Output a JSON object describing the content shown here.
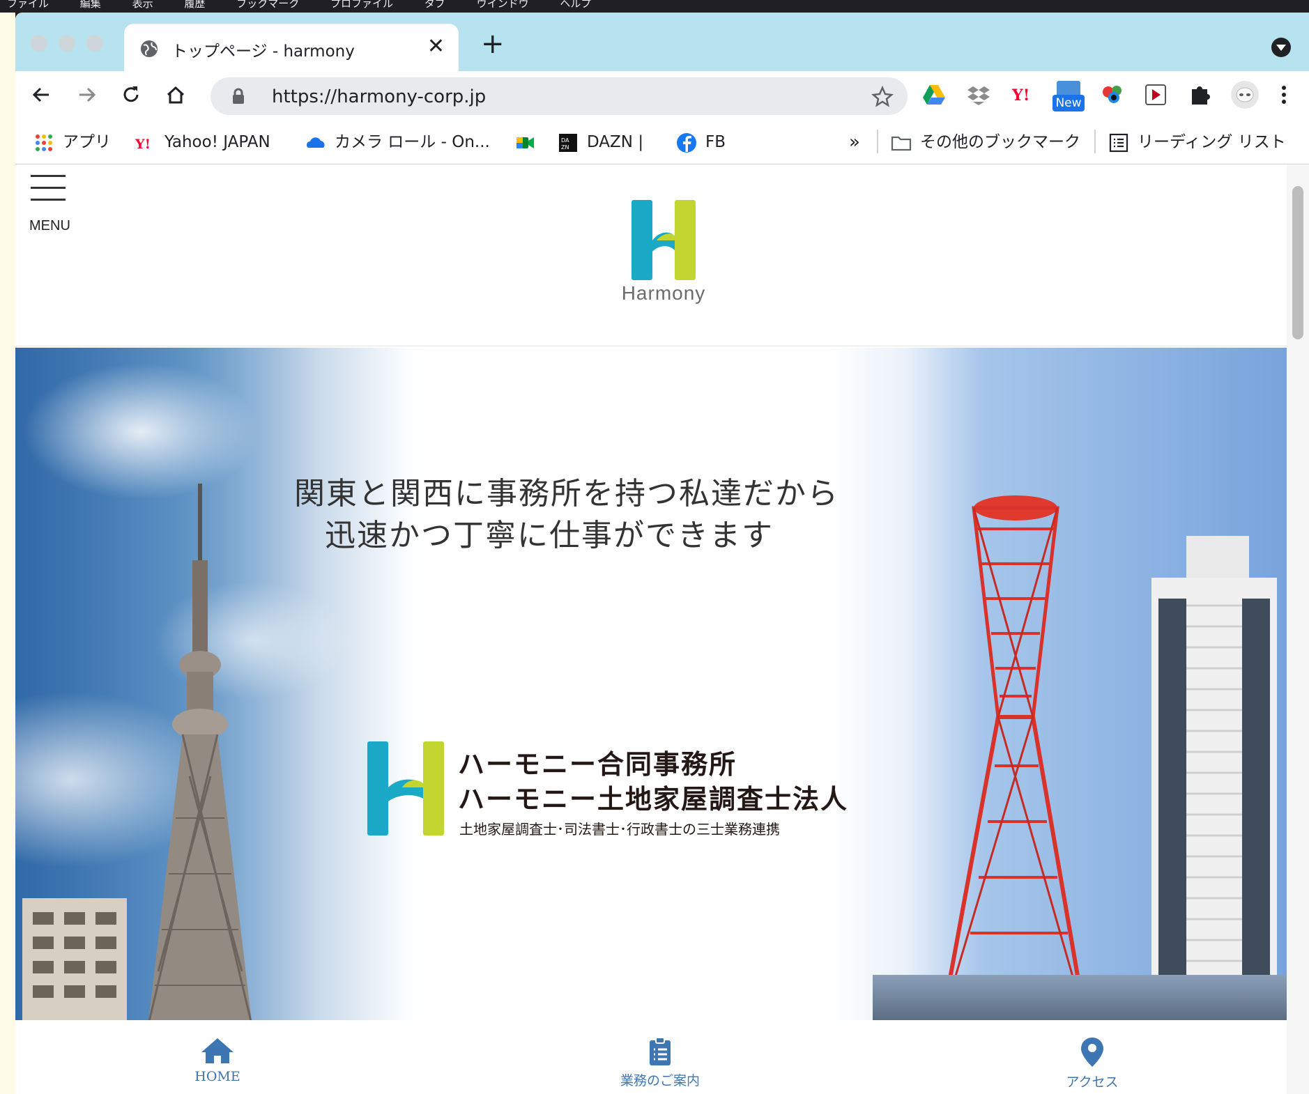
{
  "mac_menu": [
    "ファイル",
    "編集",
    "表示",
    "履歴",
    "ブックマーク",
    "プロファイル",
    "タブ",
    "ウインドウ",
    "ヘルプ"
  ],
  "tab": {
    "title": "トップページ - harmony",
    "close": "✕",
    "new_tab": "+"
  },
  "toolbar": {
    "url": "https://harmony-corp.jp",
    "ext_new_badge": "New"
  },
  "bookmarks": {
    "apps": "アプリ",
    "yahoo": "Yahoo! JAPAN",
    "camera": "カメラ ロール - On...",
    "dazn": "DAZN |",
    "fb": "FB",
    "overflow": "»",
    "other": "その他のブックマーク",
    "reading": "リーディング リスト"
  },
  "site": {
    "menu_label": "MENU",
    "logo_text": "Harmony",
    "tagline_1": "関東と関西に事務所を持つ私達だから",
    "tagline_2": "迅速かつ丁寧に仕事ができます",
    "corp_line1": "ハーモニー合同事務所",
    "corp_line2": "ハーモニー土地家屋調査士法人",
    "corp_sub": "土地家屋調査士･司法書士･行政書士の三士業務連携"
  },
  "bottom_nav": [
    {
      "label": "HOME",
      "icon": "home-icon"
    },
    {
      "label": "業務のご案内",
      "icon": "clipboard-list-icon"
    },
    {
      "label": "アクセス",
      "icon": "map-pin-icon"
    }
  ],
  "colors": {
    "logo_blue": "#1ba9c8",
    "logo_green": "#c2d530",
    "nav_blue": "#3d76b3",
    "tab_strip": "#b6e3ef"
  }
}
